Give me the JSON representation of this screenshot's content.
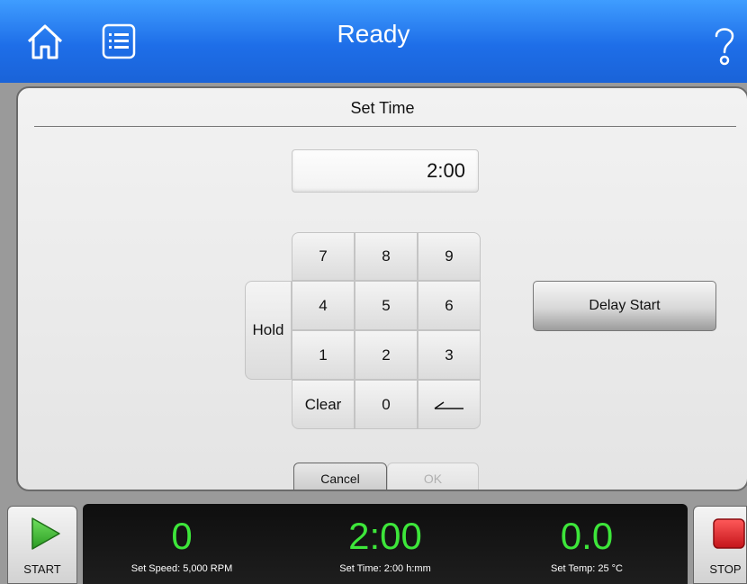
{
  "header": {
    "title": "Ready"
  },
  "panel": {
    "title": "Set Time"
  },
  "display": {
    "value": "2:00"
  },
  "keypad": {
    "hold": "Hold",
    "k7": "7",
    "k8": "8",
    "k9": "9",
    "k4": "4",
    "k5": "5",
    "k6": "6",
    "k1": "1",
    "k2": "2",
    "k3": "3",
    "clear": "Clear",
    "k0": "0",
    "enter_icon": "enter-arrow-icon"
  },
  "delay_start": "Delay Start",
  "dialog": {
    "cancel": "Cancel",
    "ok": "OK"
  },
  "status": {
    "speed_value": "0",
    "speed_label": "Set Speed: 5,000 RPM",
    "time_value": "2:00",
    "time_label": "Set Time: 2:00 h:mm",
    "temp_value": "0.0",
    "temp_label": "Set Temp: 25 °C"
  },
  "controls": {
    "start": "START",
    "stop": "STOP"
  },
  "colors": {
    "header_blue": "#1e6ee8",
    "readout_green": "#3de63a",
    "stop_red": "#e3242b",
    "start_green": "#3ab02e"
  },
  "icons": {
    "home": "home-icon",
    "menu": "list-icon",
    "help": "question-mark-icon"
  }
}
